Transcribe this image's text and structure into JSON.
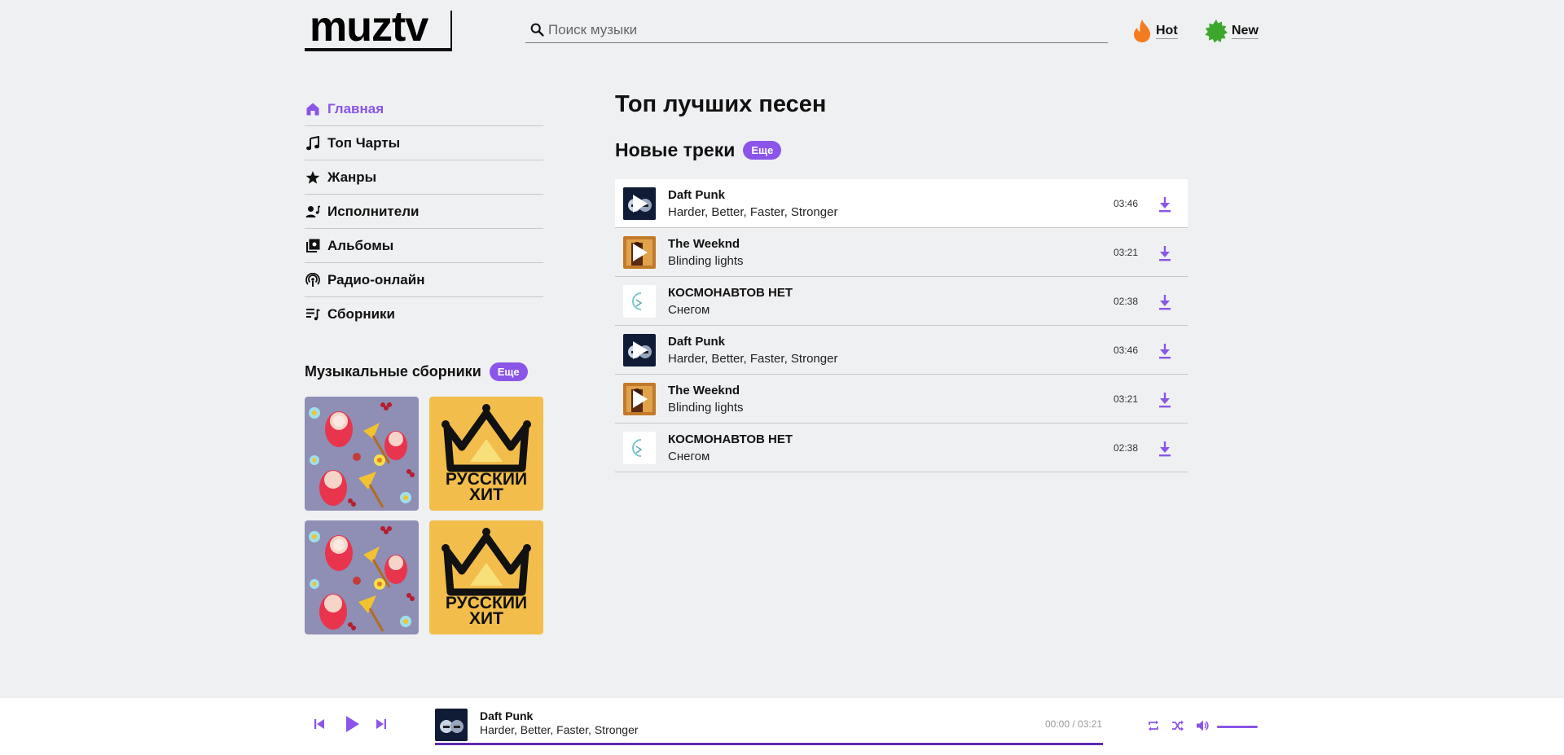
{
  "header": {
    "logo": "muztv",
    "search_placeholder": "Поиск музыки",
    "tags": [
      {
        "label": "Hot",
        "icon": "fire-icon",
        "color": "#f47b20"
      },
      {
        "label": "New",
        "icon": "new-badge-icon",
        "color": "#3ca82b"
      }
    ]
  },
  "nav": {
    "items": [
      {
        "label": "Главная",
        "icon": "home-icon",
        "active": true
      },
      {
        "label": "Топ Чарты",
        "icon": "music-note-icon"
      },
      {
        "label": "Жанры",
        "icon": "star-icon"
      },
      {
        "label": "Исполнители",
        "icon": "artist-icon"
      },
      {
        "label": "Альбомы",
        "icon": "album-icon"
      },
      {
        "label": "Радио-онлайн",
        "icon": "podcast-icon"
      },
      {
        "label": "Сборники",
        "icon": "playlist-icon"
      }
    ]
  },
  "collections": {
    "title": "Музыкальные сборники",
    "more_label": "Еще",
    "tiles": [
      {
        "kind": "pattern"
      },
      {
        "kind": "hit",
        "line1": "РУССКИЙ",
        "line2": "ХИТ"
      },
      {
        "kind": "pattern"
      },
      {
        "kind": "hit",
        "line1": "РУССКИЙ",
        "line2": "ХИТ"
      }
    ]
  },
  "main": {
    "title": "Топ лучших песен",
    "new_tracks_title": "Новые треки",
    "more_label": "Еще",
    "tracks": [
      {
        "artist": "Daft Punk",
        "title": "Harder, Better, Faster, Stronger",
        "duration": "03:46",
        "cover": "daft"
      },
      {
        "artist": "The Weeknd",
        "title": "Blinding lights",
        "duration": "03:21",
        "cover": "weeknd"
      },
      {
        "artist": "КОСМОНАВТОВ НЕТ",
        "title": "Снегом",
        "duration": "02:38",
        "cover": "kosmo"
      },
      {
        "artist": "Daft Punk",
        "title": "Harder, Better, Faster, Stronger",
        "duration": "03:46",
        "cover": "daft"
      },
      {
        "artist": "The Weeknd",
        "title": "Blinding lights",
        "duration": "03:21",
        "cover": "weeknd"
      },
      {
        "artist": "КОСМОНАВТОВ НЕТ",
        "title": "Снегом",
        "duration": "02:38",
        "cover": "kosmo"
      }
    ]
  },
  "player": {
    "artist": "Daft Punk",
    "title": "Harder, Better, Faster, Stronger",
    "time": "00:00 / 03:21",
    "progress": 1.0,
    "volume": 1.0
  },
  "colors": {
    "accent": "#8a55e8",
    "progress": "#5b2bb0",
    "background": "#eff0f2"
  }
}
